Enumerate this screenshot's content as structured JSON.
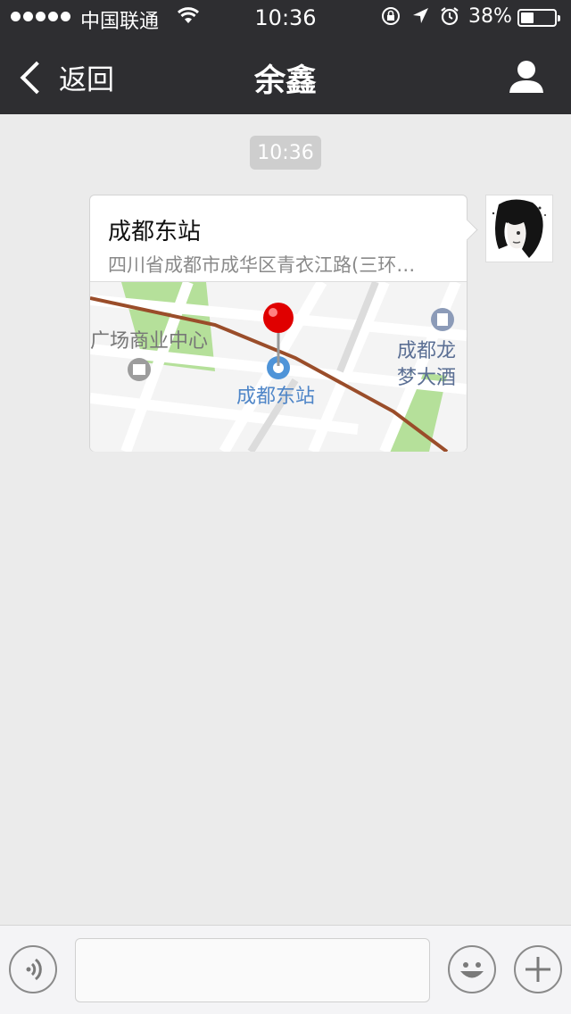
{
  "status_bar": {
    "carrier": "中国联通",
    "time": "10:36",
    "battery_percent": "38%",
    "battery_level": 0.38,
    "icons": [
      "signal-dots-icon",
      "wifi-icon",
      "rotation-lock-icon",
      "location-arrow-icon",
      "alarm-icon",
      "battery-icon"
    ]
  },
  "nav": {
    "back_label": "返回",
    "title": "余鑫",
    "profile_icon": "person-icon"
  },
  "chat": {
    "timestamp": "10:36",
    "messages": [
      {
        "type": "location",
        "title": "成都东站",
        "address": "四川省成都市成华区青衣江路(三环…",
        "map": {
          "pin_label": "成都东站",
          "labels": [
            "广场商业中心",
            "成都龙",
            "梦大酒"
          ],
          "pin_color": "#e00000",
          "road_color": "#9a4d2a",
          "park_color": "#b5e09a"
        }
      }
    ]
  },
  "input_bar": {
    "voice_icon": "voice-icon",
    "emoji_icon": "emoji-icon",
    "plus_icon": "plus-icon",
    "input_value": ""
  },
  "colors": {
    "bar_background": "#2e2e31",
    "chat_background": "#ebebeb",
    "timestamp_background": "#cecece"
  }
}
